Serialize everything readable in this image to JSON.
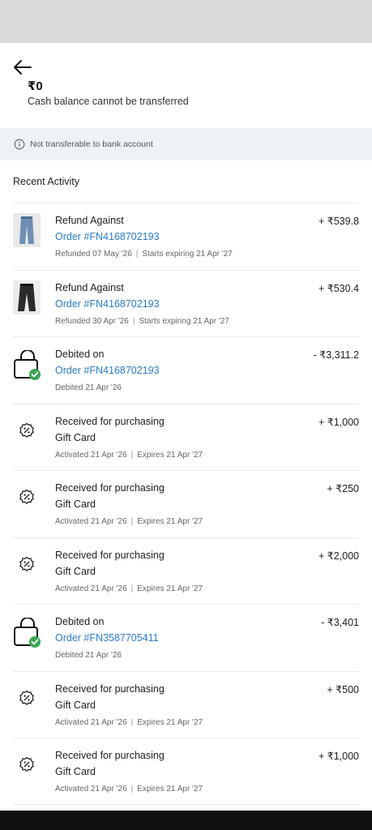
{
  "header": {
    "balance": "₹0",
    "balance_note": "Cash balance cannot be transferred"
  },
  "info": {
    "text": "Not transferable to bank account"
  },
  "section_title": "Recent Activity",
  "activities": [
    {
      "icon": "jeans-thumbnail",
      "title": "Refund Against",
      "subtitle": "Order #FN4168702193",
      "meta_left": "Refunded 07 May '26",
      "meta_right": "Starts expiring 21 Apr '27",
      "amount": "+ ₹539.8"
    },
    {
      "icon": "jeans-thumbnail",
      "title": "Refund Against",
      "subtitle": "Order #FN4168702193",
      "meta_left": "Refunded 30 Apr '26",
      "meta_right": "Starts expiring 21 Apr '27",
      "amount": "+ ₹530.4"
    },
    {
      "icon": "shopping-bag-check-icon",
      "title": "Debited on",
      "subtitle": "Order #FN4168702193",
      "meta_left": "Debited 21 Apr '26",
      "meta_right": "",
      "amount": "- ₹3,311.2"
    },
    {
      "icon": "discount-badge-icon",
      "title": "Received for purchasing",
      "subtitle": "Gift Card",
      "meta_left": "Activated 21 Apr '26",
      "meta_right": "Expires 21 Apr '27",
      "amount": "+ ₹1,000"
    },
    {
      "icon": "discount-badge-icon",
      "title": "Received for purchasing",
      "subtitle": "Gift Card",
      "meta_left": "Activated 21 Apr '26",
      "meta_right": "Expires 21 Apr '27",
      "amount": "+ ₹250"
    },
    {
      "icon": "discount-badge-icon",
      "title": "Received for purchasing",
      "subtitle": "Gift Card",
      "meta_left": "Activated 21 Apr '26",
      "meta_right": "Expires 21 Apr '27",
      "amount": "+ ₹2,000"
    },
    {
      "icon": "shopping-bag-check-icon",
      "title": "Debited on",
      "subtitle": "Order #FN3587705411",
      "meta_left": "Debited 21 Apr '26",
      "meta_right": "",
      "amount": "- ₹3,401"
    },
    {
      "icon": "discount-badge-icon",
      "title": "Received for purchasing",
      "subtitle": "Gift Card",
      "meta_left": "Activated 21 Apr '26",
      "meta_right": "Expires 21 Apr '27",
      "amount": "+ ₹500"
    },
    {
      "icon": "discount-badge-icon",
      "title": "Received for purchasing",
      "subtitle": "Gift Card",
      "meta_left": "Activated 21 Apr '26",
      "meta_right": "Expires 21 Apr '27",
      "amount": "+ ₹1,000"
    }
  ],
  "colors": {
    "link": "#2c7cc1",
    "info_strip_bg": "#eef2f5",
    "check_green": "#3aa757",
    "status_bar": "#d9d9d9"
  }
}
